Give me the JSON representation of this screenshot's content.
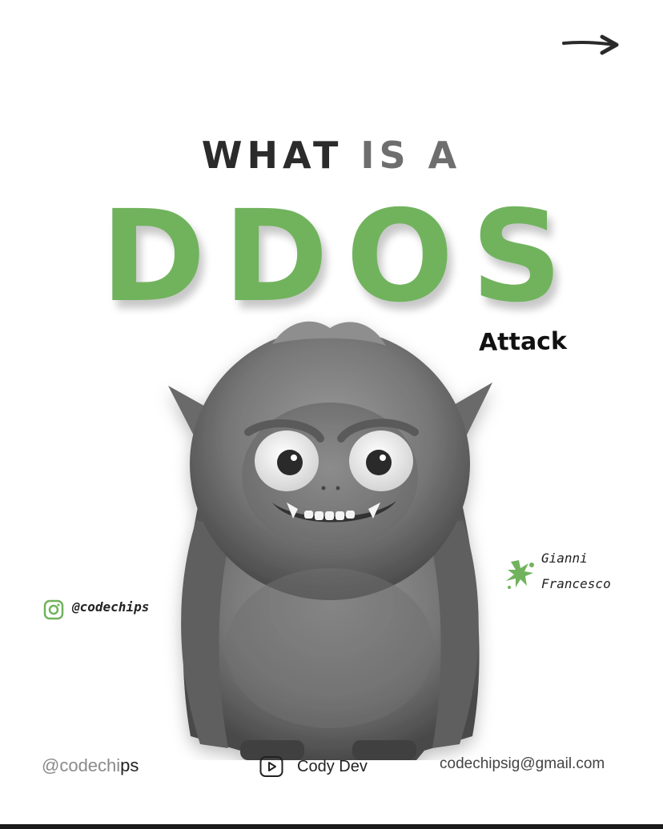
{
  "headline": {
    "word1": "WHAT",
    "word2": "IS A",
    "main": "DDOS",
    "sub": "Attack"
  },
  "author": {
    "first": "Gianni",
    "last": "Francesco"
  },
  "social": {
    "instagram": "@codechips"
  },
  "footer": {
    "handle_start": "@codechi",
    "handle_end": "ps",
    "youtube": "Cody Dev",
    "email": "codechipsig@gmail.com"
  },
  "colors": {
    "accent": "#71b35d",
    "dark": "#2b2b2b",
    "gray": "#6e6e6e"
  },
  "icons": [
    "arrow-right-icon",
    "splat-icon",
    "instagram-icon",
    "youtube-icon"
  ]
}
